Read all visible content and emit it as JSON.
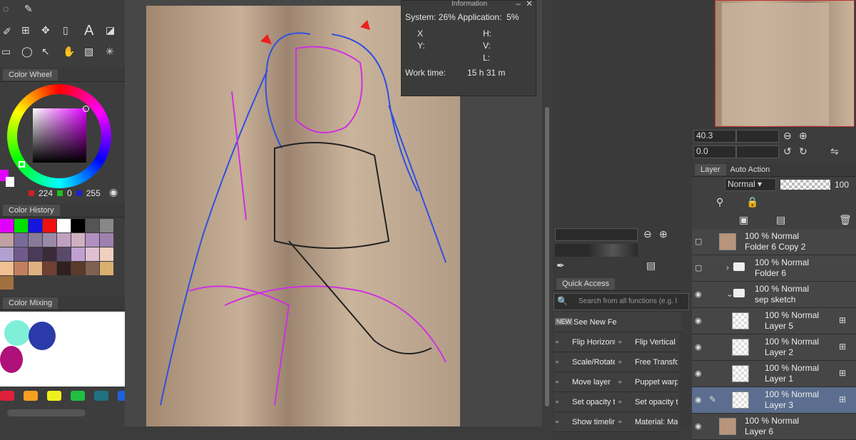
{
  "colors": {
    "accent": "#4a9bd8",
    "selected": "#5b6e8f",
    "bg": "#3c3c3c"
  },
  "tools": {
    "icons": [
      "lasso-icon",
      "eyedropper-icon",
      "pen-icon",
      "grid-icon",
      "move-icon",
      "ruler-icon",
      "text-icon",
      "fill-icon",
      "rectangle-select-icon",
      "speech-bubble-icon",
      "select-arrow-icon",
      "hand-icon",
      "gradient-icon",
      "magic-wand-icon"
    ]
  },
  "color_wheel": {
    "tab": "Color Wheel",
    "r": "224",
    "g": "0",
    "b": "255",
    "main_color": "#e000ff"
  },
  "color_history": {
    "tab": "Color History",
    "swatches": [
      "#e000ff",
      "#00e000",
      "#1515e0",
      "#ee1111",
      "#ffffff",
      "#000000",
      "#555555",
      "#888888",
      "#c0a0a0",
      "#7a6a9a",
      "#8a7a9a",
      "#9a8aaa",
      "#c0a0c0",
      "#d0b0c0",
      "#b090c0",
      "#a080b0",
      "#b0a0d0",
      "#705a8a",
      "#4a3a5a",
      "#3a2a3a",
      "#5a4a6a",
      "#c0a0d0",
      "#e0c0d0",
      "#f0d0c0",
      "#f0c090",
      "#c08060",
      "#e0b080",
      "#704030",
      "#302020",
      "#5a3a2a",
      "#806050",
      "#d8b070",
      "#a07040"
    ]
  },
  "color_mixing": {
    "tab": "Color Mixing",
    "palette": [
      "#e0203a",
      "#f5a020",
      "#f0f020",
      "#20c040",
      "#207080",
      "#2060e0"
    ]
  },
  "information": {
    "title": "Information",
    "system": "System: 26% Application:  5%",
    "x": "X",
    "y": "Y:",
    "h": "H:",
    "v": "V:",
    "l": "L:",
    "work_time_label": "Work time:",
    "work_time_value": "15 h 31 m"
  },
  "navigator": {
    "zoom": "40.3",
    "rotate": "0.0"
  },
  "layer_panel": {
    "tab_layer": "Layer",
    "tab_auto": "Auto Action",
    "blend": "Normal",
    "opacity": "100",
    "layers": [
      {
        "pct": "100 %",
        "mode": "Normal",
        "name": "Folder 6 Copy 2",
        "type": "folder-thumb"
      },
      {
        "pct": "100 %",
        "mode": "Normal",
        "name": "Folder 6",
        "type": "folder"
      },
      {
        "pct": "100 %",
        "mode": "Normal",
        "name": "sep sketch",
        "type": "folder-open"
      },
      {
        "pct": "100 %",
        "mode": "Normal",
        "name": "Layer 5",
        "type": "layer"
      },
      {
        "pct": "100 %",
        "mode": "Normal",
        "name": "Layer 2",
        "type": "layer"
      },
      {
        "pct": "100 %",
        "mode": "Normal",
        "name": "Layer 1",
        "type": "layer"
      },
      {
        "pct": "100 %",
        "mode": "Normal",
        "name": "Layer 3",
        "type": "layer"
      },
      {
        "pct": "100 %",
        "mode": "Normal",
        "name": "Layer 6",
        "type": "image"
      }
    ]
  },
  "quick_access": {
    "tab": "Quick Access",
    "search_placeholder": "Search from all functions (e.g. l",
    "see_new": "See New Fe",
    "items": [
      [
        "Flip Horizonta",
        "Flip Vertical"
      ],
      [
        "Scale/Rotate",
        "Free Transfo"
      ],
      [
        "Move layer",
        "Puppet warp"
      ],
      [
        "Set opacity to",
        "Set opacity to"
      ],
      [
        "Show timelin",
        "Material: Ma"
      ]
    ]
  },
  "bottom": {
    "left_field": "40.3",
    "mid_field": "0.0"
  }
}
